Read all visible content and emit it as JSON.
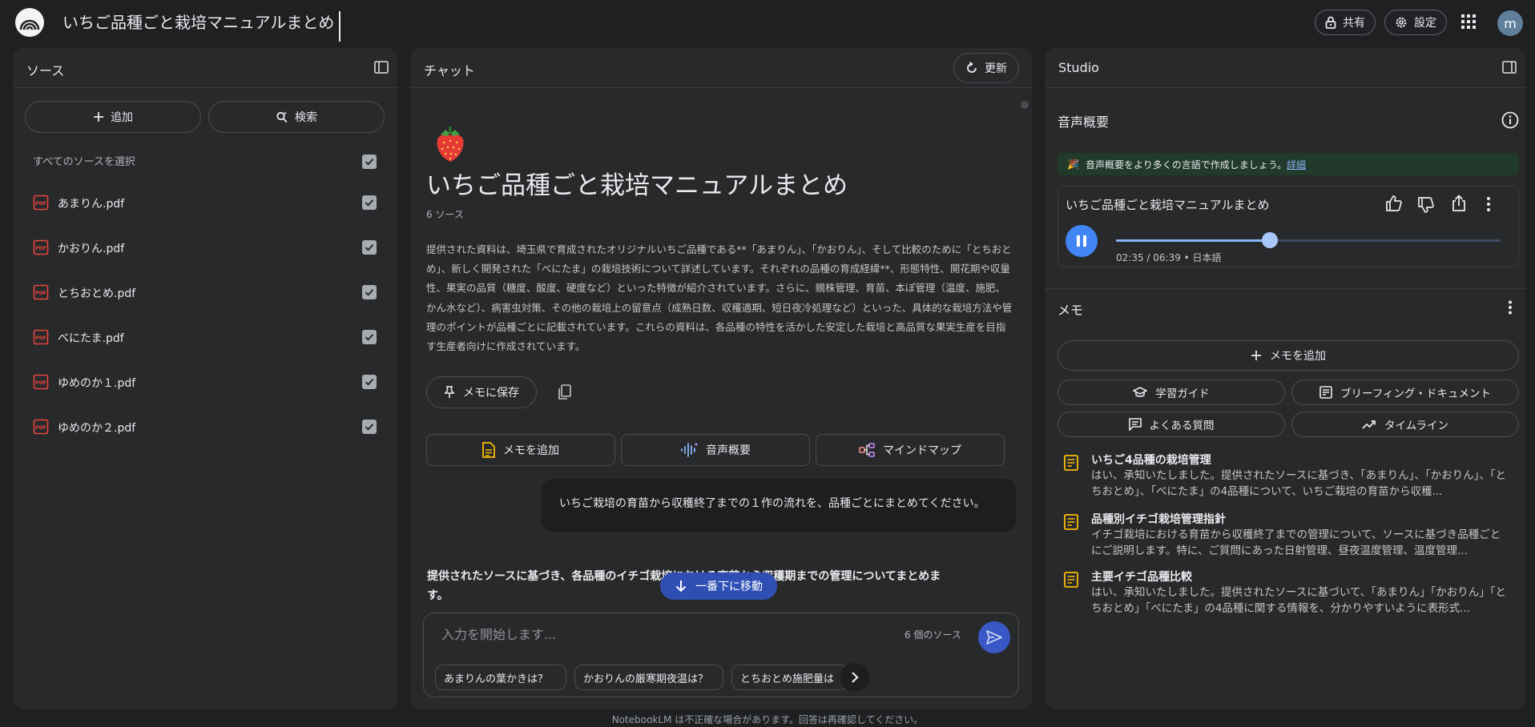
{
  "header": {
    "title": "いちご品種ごと栽培マニュアルまとめ",
    "share_label": "共有",
    "settings_label": "設定",
    "avatar_letter": "m"
  },
  "sources": {
    "title": "ソース",
    "add_label": "追加",
    "search_label": "検索",
    "select_all_label": "すべてのソースを選択",
    "items": [
      {
        "name": "あまりん.pdf",
        "checked": true
      },
      {
        "name": "かおりん.pdf",
        "checked": true
      },
      {
        "name": "とちおとめ.pdf",
        "checked": true
      },
      {
        "name": "べにたま.pdf",
        "checked": true
      },
      {
        "name": "ゆめのか１.pdf",
        "checked": true
      },
      {
        "name": "ゆめのか２.pdf",
        "checked": true
      }
    ]
  },
  "chat": {
    "title": "チャット",
    "refresh_label": "更新",
    "emoji": "🍓",
    "notebook_title": "いちご品種ごと栽培マニュアルまとめ",
    "source_count": "6 ソース",
    "summary": "提供された資料は、埼玉県で育成されたオリジナルいちご品種である**「あまりん」、「かおりん」、そして比較のために「とちおとめ」、新しく開発された「べにたま」の栽培技術について詳述しています。それぞれの品種の育成経緯**、形態特性、開花期や収量性、果実の品質（糖度、酸度、硬度など）といった特徴が紹介されています。さらに、親株管理、育苗、本ぽ管理（温度、施肥、かん水など）、病害虫対策、その他の栽培上の留意点（成熟日数、収穫適期、短日夜冷処理など）といった、具体的な栽培方法や管理のポイントが品種ごとに記載されています。これらの資料は、各品種の特性を活かした安定した栽培と高品質な果実生産を目指す生産者向けに作成されています。",
    "save_memo_label": "メモに保存",
    "add_memo_label": "メモを追加",
    "audio_overview_label": "音声概要",
    "mindmap_label": "マインドマップ",
    "user_message": "いちご栽培の育苗から収穫終了までの１作の流れを、品種ごとにまとめてください。",
    "answer_text": "提供されたソースに基づき、各品種のイチゴ栽培における育苗から収穫期までの管理についてまとめます。",
    "scroll_down_label": "一番下に移動",
    "input_placeholder": "入力を開始します...",
    "input_source_count": "6 個のソース",
    "suggestions": [
      "あまりんの葉かきは？",
      "かおりんの厳寒期夜温は？",
      "とちおとめ施肥量は"
    ]
  },
  "studio": {
    "title": "Studio",
    "audio_section_title": "音声概要",
    "banner_emoji": "🎉",
    "banner_text": "音声概要をより多くの言語で作成しましょう。",
    "banner_link": "詳細",
    "audio_card_title": "いちご品種ごと栽培マニュアルまとめ",
    "audio_time": "02:35 / 06:39 • 日本語",
    "audio_progress": 0.4,
    "memo_section_title": "メモ",
    "add_memo_label": "メモを追加",
    "study_guide_label": "学習ガイド",
    "briefing_label": "ブリーフィング・ドキュメント",
    "faq_label": "よくある質問",
    "timeline_label": "タイムライン",
    "memos": [
      {
        "title": "いちご4品種の栽培管理",
        "body": "はい、承知いたしました。提供されたソースに基づき、「あまりん」、「かおりん」、「とちおとめ」、「べにたま」の4品種について、いちご栽培の育苗から収穫..."
      },
      {
        "title": "品種別イチゴ栽培管理指針",
        "body": "イチゴ栽培における育苗から収穫終了までの管理について、ソースに基づき品種ごとにご説明します。特に、ご質問にあった日射管理、昼夜温度管理、温度管理..."
      },
      {
        "title": "主要イチゴ品種比較",
        "body": "はい、承知いたしました。提供されたソースに基づいて、「あまりん」「かおりん」「とちおとめ」「べにたま」の4品種に関する情報を、分かりやすいように表形式..."
      }
    ]
  },
  "footer": {
    "disclaimer": "NotebookLM は不正確な場合があります。回答は再確認してください。"
  },
  "colors": {
    "background": "#1f2022",
    "panel": "#28292b",
    "accent_blue": "#4285f4",
    "pdf_red": "#e8453c",
    "memo_yellow": "#f5b400"
  }
}
